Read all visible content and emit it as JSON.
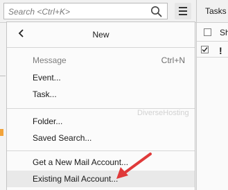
{
  "toolbar": {
    "search_placeholder": "Search <Ctrl+K>",
    "search_icon": "magnifier-icon",
    "menu_icon": "hamburger-menu-icon"
  },
  "right_panel": {
    "tab_label": "Tasks",
    "column_label": "Sh",
    "flag": "!"
  },
  "menu": {
    "title": "New",
    "back_icon": "chevron-left-icon",
    "groups": [
      [
        {
          "label": "Message",
          "shortcut": "Ctrl+N",
          "disabled": true
        },
        {
          "label": "Event..."
        },
        {
          "label": "Task..."
        }
      ],
      [
        {
          "label": "Folder..."
        },
        {
          "label": "Saved Search..."
        }
      ],
      [
        {
          "label": "Get a New Mail Account..."
        },
        {
          "label": "Existing Mail Account...",
          "highlighted": true
        }
      ]
    ]
  },
  "watermark": "DiverseHosting",
  "annotation": {
    "arrow_color": "#e03a3a",
    "arrow_icon": "red-pointer-arrow-icon"
  }
}
